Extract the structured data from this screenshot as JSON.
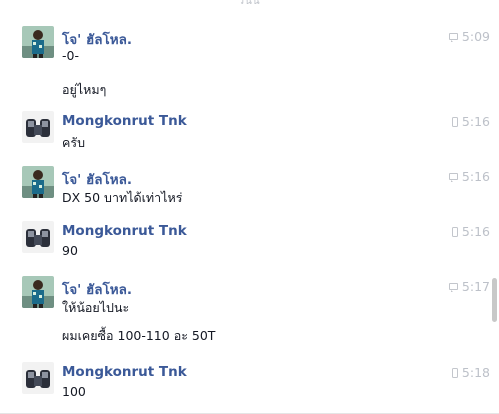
{
  "top_label": "วันนี้",
  "messages": [
    {
      "sender": "โจ' ฮัลโหล.",
      "avatar": "joe",
      "time": "5:09",
      "via": "chat",
      "lines": [
        "-0-",
        "อยู่ไหมๆ"
      ]
    },
    {
      "sender": "Mongkonrut Tnk",
      "avatar": "mong",
      "time": "5:16",
      "via": "mobile",
      "lines": [
        "ครับ"
      ]
    },
    {
      "sender": "โจ' ฮัลโหล.",
      "avatar": "joe",
      "time": "5:16",
      "via": "chat",
      "lines": [
        "DX 50 บาทได้เท่าไหร่"
      ]
    },
    {
      "sender": "Mongkonrut Tnk",
      "avatar": "mong",
      "time": "5:16",
      "via": "mobile",
      "lines": [
        "90"
      ]
    },
    {
      "sender": "โจ' ฮัลโหล.",
      "avatar": "joe",
      "time": "5:17",
      "via": "chat",
      "lines": [
        "ให้น้อยไปนะ",
        "ผมเคยซื้อ 100-110 อะ 50T"
      ]
    },
    {
      "sender": "Mongkonrut Tnk",
      "avatar": "mong",
      "time": "5:18",
      "via": "mobile",
      "lines": [
        "100"
      ]
    }
  ]
}
